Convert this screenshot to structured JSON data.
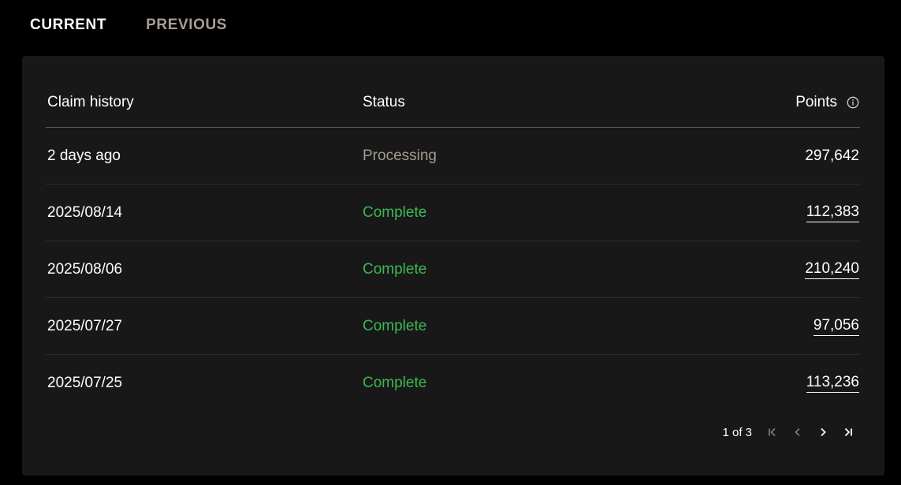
{
  "tabs": [
    {
      "label": "CURRENT",
      "active": true
    },
    {
      "label": "PREVIOUS",
      "active": false
    }
  ],
  "table": {
    "columns": {
      "date": "Claim history",
      "status": "Status",
      "points": "Points"
    },
    "rows": [
      {
        "date": "2 days ago",
        "status": "Processing",
        "points": "297,642"
      },
      {
        "date": "2025/08/14",
        "status": "Complete",
        "points": "112,383"
      },
      {
        "date": "2025/08/06",
        "status": "Complete",
        "points": "210,240"
      },
      {
        "date": "2025/07/27",
        "status": "Complete",
        "points": "97,056"
      },
      {
        "date": "2025/07/25",
        "status": "Complete",
        "points": "113,236"
      }
    ]
  },
  "pagination": {
    "text": "1 of 3"
  },
  "icons": {
    "points_info": "info-icon",
    "first": "first-page-icon",
    "prev": "chevron-left-icon",
    "next": "chevron-right-icon",
    "last": "last-page-icon"
  },
  "colors": {
    "background": "#000000",
    "panel": "#181818",
    "complete": "#3cb853",
    "processing": "#a39a90",
    "tab_inactive": "#a89f95"
  }
}
